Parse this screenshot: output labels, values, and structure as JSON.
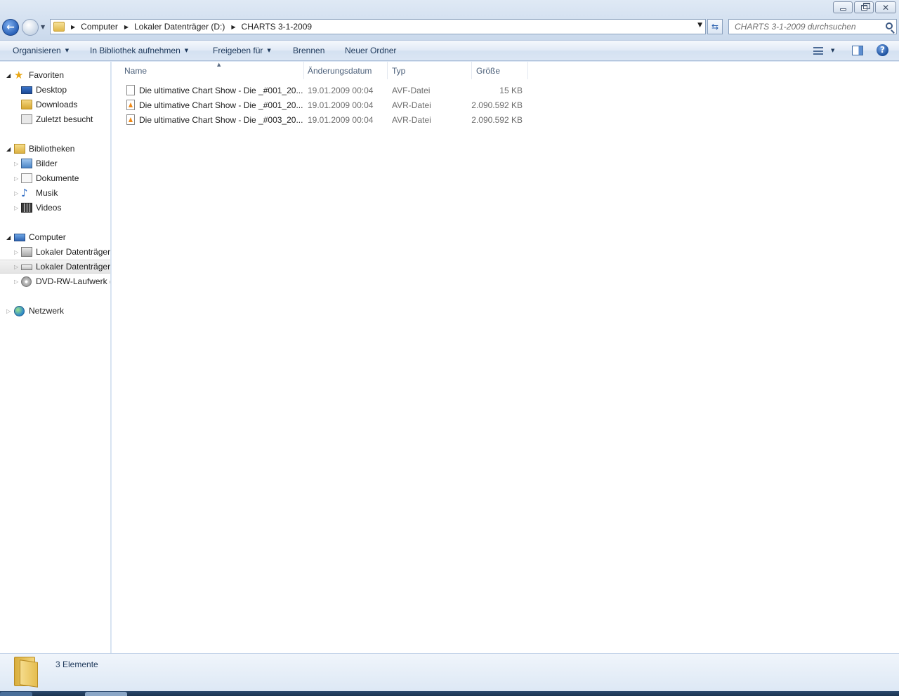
{
  "window": {
    "search_placeholder": "CHARTS 3-1-2009 durchsuchen"
  },
  "address": {
    "crumbs": [
      "Computer",
      "Lokaler Datenträger (D:)",
      "CHARTS 3-1-2009"
    ]
  },
  "toolbar": {
    "organize": "Organisieren",
    "include_library": "In Bibliothek aufnehmen",
    "share": "Freigeben für",
    "burn": "Brennen",
    "new_folder": "Neuer Ordner"
  },
  "nav": {
    "favorites": "Favoriten",
    "desktop": "Desktop",
    "downloads": "Downloads",
    "recent": "Zuletzt besucht",
    "libraries": "Bibliotheken",
    "pictures": "Bilder",
    "documents": "Dokumente",
    "music": "Musik",
    "videos": "Videos",
    "computer": "Computer",
    "drive_c": "Lokaler Datenträger",
    "drive_d": "Lokaler Datenträger",
    "dvd": "DVD-RW-Laufwerk (",
    "network": "Netzwerk"
  },
  "columns": {
    "name": "Name",
    "date": "Änderungsdatum",
    "type": "Typ",
    "size": "Größe"
  },
  "files": [
    {
      "name": "Die ultimative Chart Show - Die _#001_20...",
      "date": "19.01.2009 00:04",
      "type": "AVF-Datei",
      "size": "15 KB",
      "icon": "generic-file-icon"
    },
    {
      "name": "Die ultimative Chart Show - Die _#001_20...",
      "date": "19.01.2009 00:04",
      "type": "AVR-Datei",
      "size": "2.090.592 KB",
      "icon": "vlc-file-icon"
    },
    {
      "name": "Die ultimative Chart Show - Die _#003_20...",
      "date": "19.01.2009 00:04",
      "type": "AVR-Datei",
      "size": "2.090.592 KB",
      "icon": "vlc-file-icon"
    }
  ],
  "details": {
    "count": "3 Elemente"
  },
  "colors": {
    "accent": "#1e395b",
    "selection": "#e4e4e4",
    "vlc": "#f08a17"
  }
}
